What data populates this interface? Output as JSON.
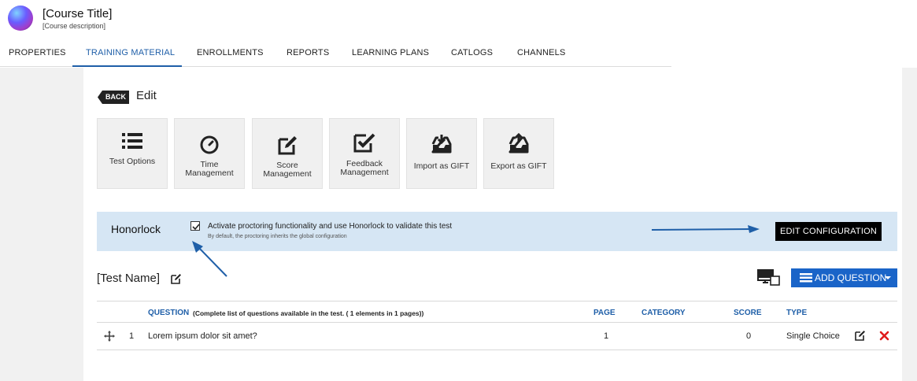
{
  "header": {
    "course_title": "[Course Title]",
    "course_description": "[Course description]"
  },
  "tabs": [
    {
      "label": "PROPERTIES"
    },
    {
      "label": "TRAINING MATERIAL",
      "active": true
    },
    {
      "label": "ENROLLMENTS"
    },
    {
      "label": "REPORTS"
    },
    {
      "label": "LEARNING PLANS"
    },
    {
      "label": "CATLOGS"
    },
    {
      "label": "CHANNELS"
    }
  ],
  "edit": {
    "back_label": "BACK",
    "title": "Edit"
  },
  "tools": [
    {
      "label_lines": [
        "Test Options"
      ],
      "icon": "list-icon"
    },
    {
      "label_lines": [
        "Time",
        "Management"
      ],
      "icon": "clock-icon"
    },
    {
      "label_lines": [
        "Score",
        "Management"
      ],
      "icon": "edit-square-icon"
    },
    {
      "label_lines": [
        "Feedback",
        "Management"
      ],
      "icon": "checkbox-icon"
    },
    {
      "label_lines": [
        "Import as GIFT"
      ],
      "icon": "inbox-download-icon"
    },
    {
      "label_lines": [
        "Export as GIFT"
      ],
      "icon": "inbox-upload-icon"
    }
  ],
  "honorlock": {
    "title": "Honorlock",
    "checkbox_checked": true,
    "checkbox_label": "Activate proctoring functionality and use Honorlock to validate this test",
    "sub_text": "By default, the proctoring inherits the global configuration",
    "edit_config_label": "EDIT CONFIGURATION"
  },
  "test": {
    "name": "[Test Name]",
    "add_question_label": "ADD QUESTION"
  },
  "table": {
    "headers": {
      "question": "QUESTION",
      "question_note": "(Complete list of questions available in the test. ( 1 elements in 1 pages))",
      "page": "PAGE",
      "category": "CATEGORY",
      "score": "SCORE",
      "type": "TYPE"
    },
    "rows": [
      {
        "index": "1",
        "question": "Lorem ipsum dolor sit amet?",
        "page": "1",
        "category": "",
        "score": "0",
        "type": "Single Choice"
      }
    ]
  },
  "colors": {
    "accent": "#1f5fa8",
    "add_button": "#1a64c8",
    "honorlock_bg": "#d6e6f4",
    "delete": "#e01b1b"
  }
}
